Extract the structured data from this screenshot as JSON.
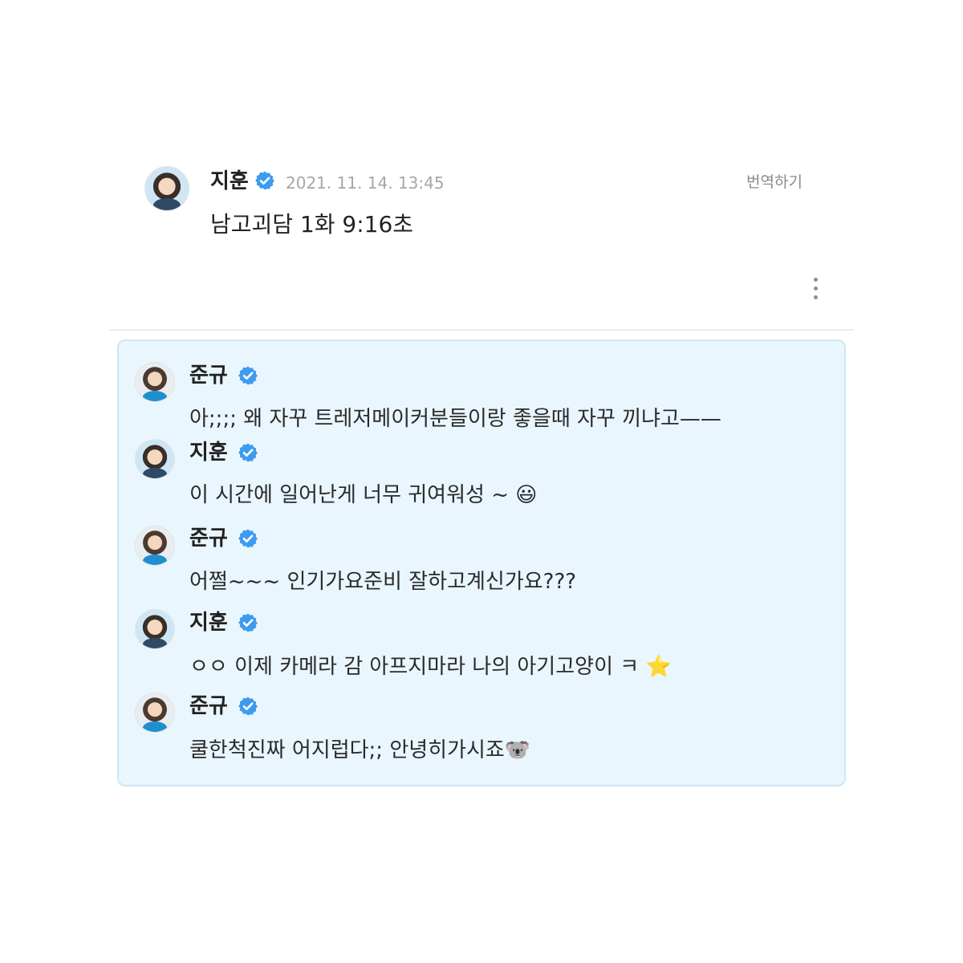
{
  "post": {
    "author": "지훈",
    "timestamp": "2021. 11. 14. 13:45",
    "translate_label": "번역하기",
    "text": "남고괴담 1화 9:16초"
  },
  "replies": [
    {
      "author": "준규",
      "text": "아;;;; 왜 자꾸 트레저메이커분들이랑 좋을때 자꾸 끼냐고——"
    },
    {
      "author": "지훈",
      "text": "이 시간에 일어난게 너무 귀여워성 ~ 😃"
    },
    {
      "author": "준규",
      "text": "어쩔~~~ 인기가요준비 잘하고계신가요???"
    },
    {
      "author": "지훈",
      "text": "ㅇㅇ 이제 카메라 감 아프지마라 나의 아기고양이 ㅋ ⭐"
    },
    {
      "author": "준규",
      "text": "쿨한척진짜 어지럽다;; 안녕히가시죠🐨"
    }
  ],
  "icons": {
    "verified": "verified-badge-icon",
    "more": "more-vertical-icon"
  },
  "colors": {
    "verified_blue": "#3d9bf0",
    "reply_background": "#e9f6fd",
    "reply_border": "#cfe6f3",
    "timestamp_gray": "#a6a6a6"
  }
}
